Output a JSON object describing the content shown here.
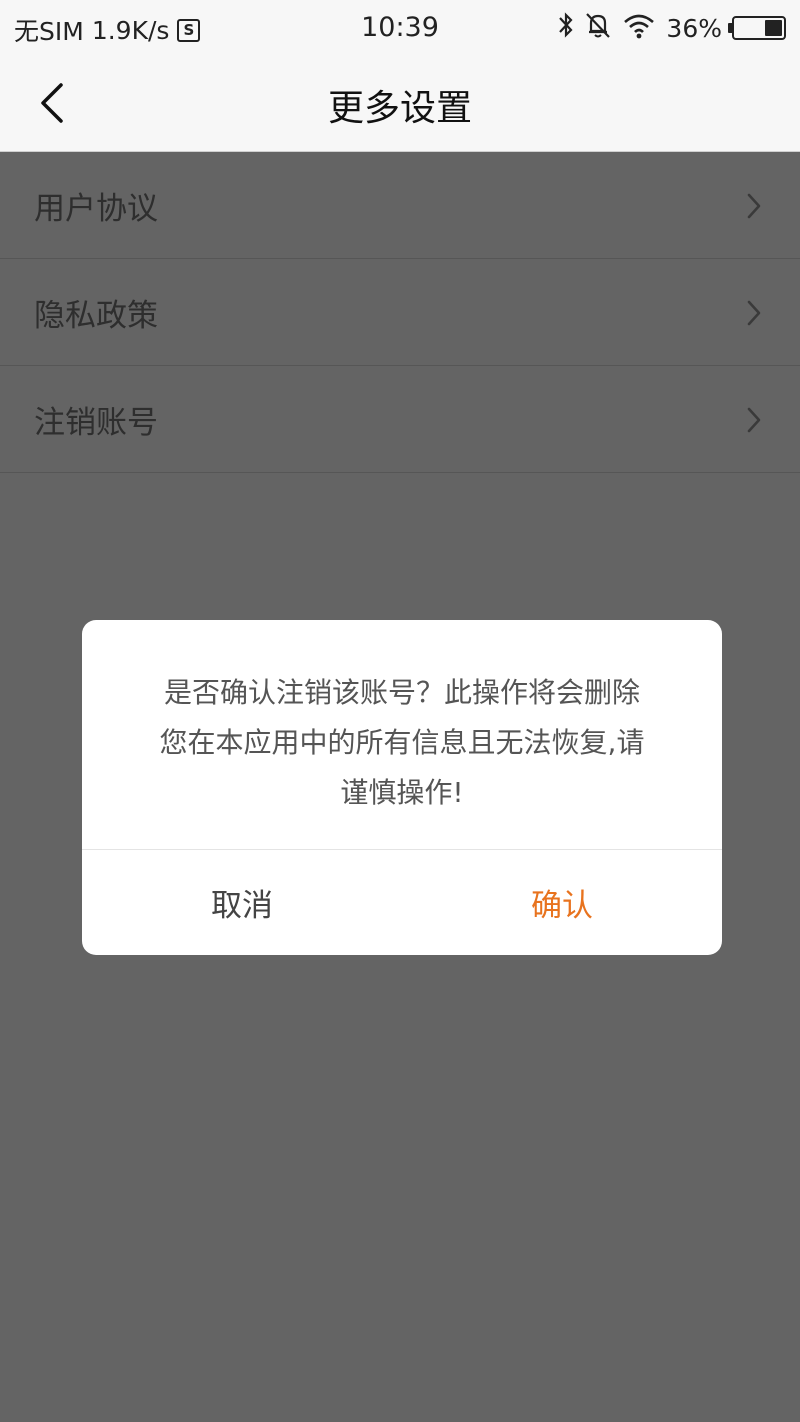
{
  "status_bar": {
    "carrier": "无SIM",
    "speed": "1.9K/s",
    "time": "10:39",
    "battery": "36%",
    "battery_level": 0.36,
    "icons": [
      "s-app-icon",
      "bluetooth-icon",
      "mute-bell-icon",
      "wifi-icon",
      "battery-icon"
    ]
  },
  "nav": {
    "title": "更多设置",
    "back_icon": "chevron-left-icon"
  },
  "menu": {
    "items": [
      {
        "label": "用户协议"
      },
      {
        "label": "隐私政策"
      },
      {
        "label": "注销账号"
      }
    ]
  },
  "dialog": {
    "message_lines": [
      "是否确认注销该账号？此操作将会删除",
      "您在本应用中的所有信息且无法恢复,请",
      "谨慎操作!"
    ],
    "cancel_label": "取消",
    "confirm_label": "确认"
  },
  "colors": {
    "overlay": "#646464",
    "accent": "#e8731e",
    "nav_bg": "#f7f7f7"
  }
}
